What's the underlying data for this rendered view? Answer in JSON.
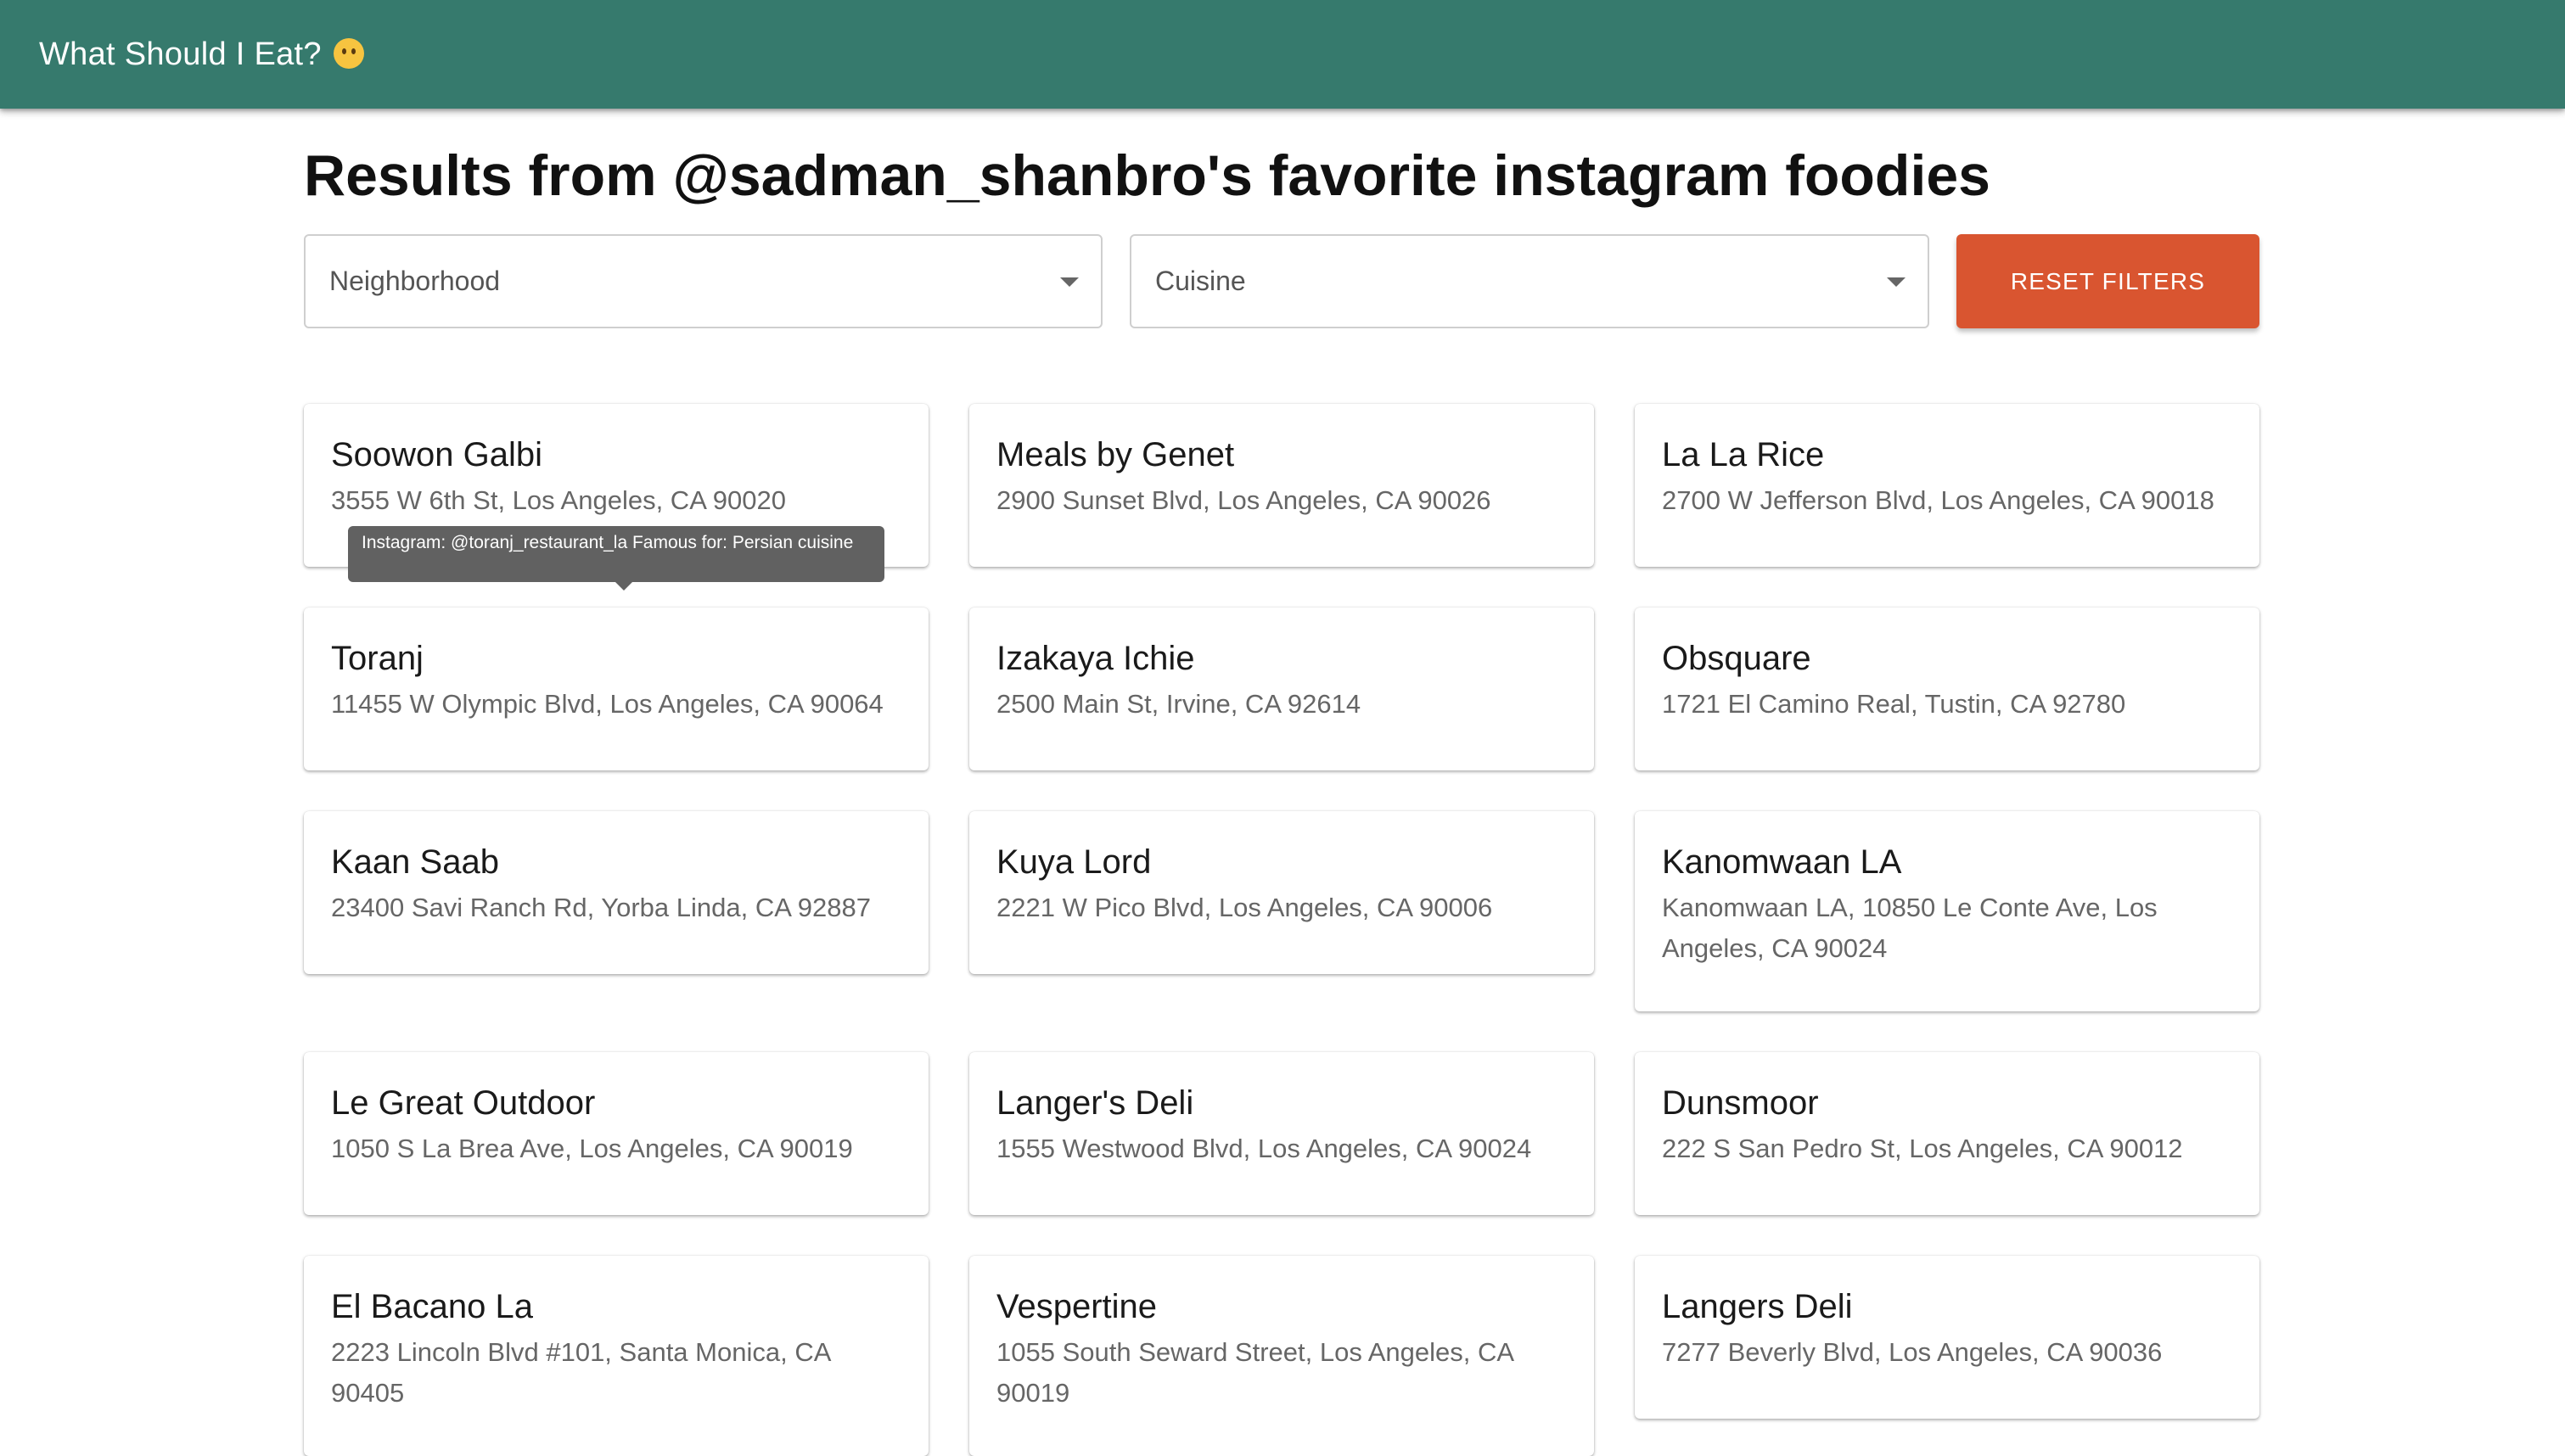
{
  "app": {
    "title": "What Should I Eat?",
    "emoji": "thinking-face-icon"
  },
  "page": {
    "title": "Results from @sadman_shanbro's favorite instagram foodies"
  },
  "filters": {
    "neighborhood_label": "Neighborhood",
    "cuisine_label": "Cuisine",
    "reset_label": "RESET FILTERS"
  },
  "tooltip": {
    "text": "Instagram: @toranj_restaurant_la Famous for: Persian cuisine"
  },
  "colors": {
    "appbar": "#367a6d",
    "reset_button": "#d95530",
    "tooltip": "#616161"
  },
  "restaurants": [
    {
      "name": "Soowon Galbi",
      "address": "3555 W 6th St, Los Angeles, CA 90020"
    },
    {
      "name": "Meals by Genet",
      "address": "2900 Sunset Blvd, Los Angeles, CA 90026"
    },
    {
      "name": "La La Rice",
      "address": "2700 W Jefferson Blvd, Los Angeles, CA 90018"
    },
    {
      "name": "Toranj",
      "address": "11455 W Olympic Blvd, Los Angeles, CA 90064"
    },
    {
      "name": "Izakaya Ichie",
      "address": "2500 Main St, Irvine, CA 92614"
    },
    {
      "name": "Obsquare",
      "address": "1721 El Camino Real, Tustin, CA 92780"
    },
    {
      "name": "Kaan Saab",
      "address": "23400 Savi Ranch Rd, Yorba Linda, CA 92887"
    },
    {
      "name": "Kuya Lord",
      "address": "2221 W Pico Blvd, Los Angeles, CA 90006"
    },
    {
      "name": "Kanomwaan LA",
      "address": "Kanomwaan LA, 10850 Le Conte Ave, Los Angeles, CA 90024"
    },
    {
      "name": "Le Great Outdoor",
      "address": "1050 S La Brea Ave, Los Angeles, CA 90019"
    },
    {
      "name": "Langer's Deli",
      "address": "1555 Westwood Blvd, Los Angeles, CA 90024"
    },
    {
      "name": "Dunsmoor",
      "address": "222 S San Pedro St, Los Angeles, CA 90012"
    },
    {
      "name": "El Bacano La",
      "address": "2223 Lincoln Blvd #101, Santa Monica, CA 90405"
    },
    {
      "name": "Vespertine",
      "address": "1055 South Seward Street, Los Angeles, CA 90019"
    },
    {
      "name": "Langers Deli",
      "address": "7277 Beverly Blvd, Los Angeles, CA 90036"
    }
  ]
}
